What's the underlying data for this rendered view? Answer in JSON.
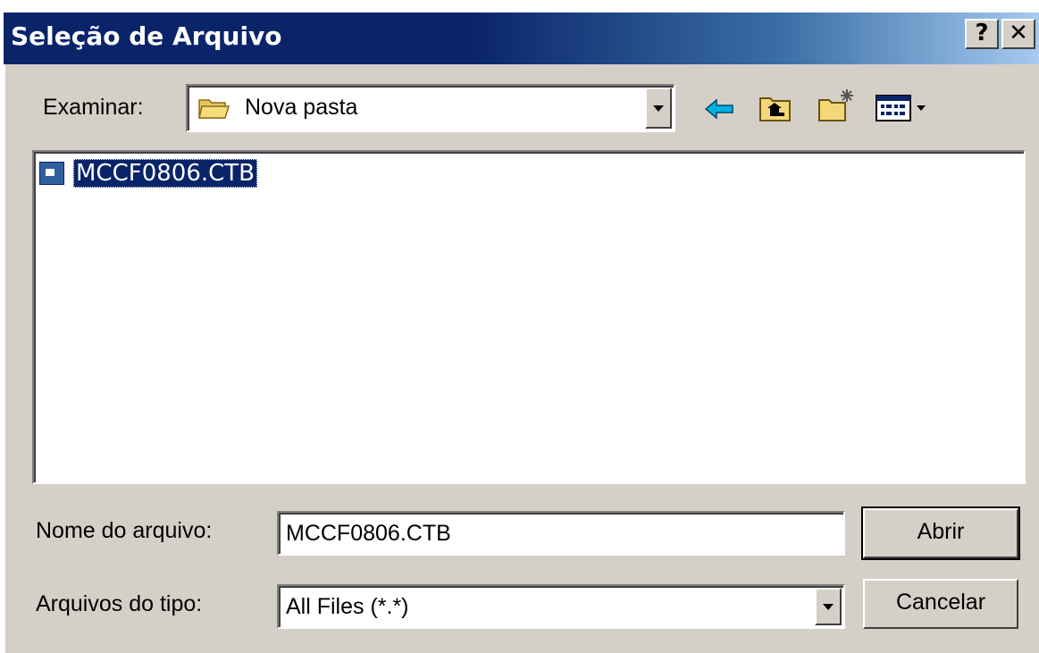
{
  "window": {
    "title": "Seleção de Arquivo",
    "help_label": "?",
    "close_label": "✕"
  },
  "look_in": {
    "label": "Examinar:",
    "value": "Nova pasta"
  },
  "toolbar": {
    "icons": [
      "back-arrow-icon",
      "up-folder-icon",
      "new-folder-icon",
      "view-menu-icon"
    ]
  },
  "file_list": {
    "items": [
      {
        "name": "MCCF0806.CTB",
        "selected": true
      }
    ]
  },
  "file_name": {
    "label": "Nome do arquivo:",
    "value": "MCCF0806.CTB"
  },
  "file_type": {
    "label": "Arquivos do tipo:",
    "value": "All Files (*.*)"
  },
  "buttons": {
    "open_label": "Abrir",
    "cancel_label": "Cancelar"
  },
  "colors": {
    "title_bar": "#0a246a",
    "face": "#d4d0c8",
    "selection": "#0a246a"
  }
}
